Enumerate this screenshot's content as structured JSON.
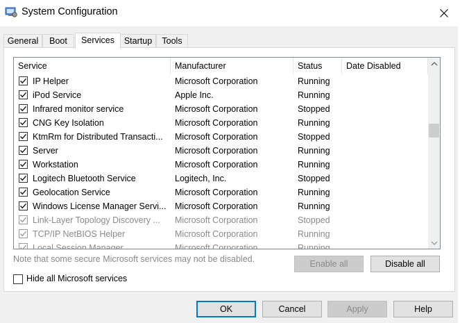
{
  "window": {
    "title": "System Configuration",
    "icon": "system-config-icon"
  },
  "tabs": [
    {
      "label": "General",
      "active": false
    },
    {
      "label": "Boot",
      "active": false
    },
    {
      "label": "Services",
      "active": true
    },
    {
      "label": "Startup",
      "active": false
    },
    {
      "label": "Tools",
      "active": false
    }
  ],
  "services": {
    "columns": [
      "Service",
      "Manufacturer",
      "Status",
      "Date Disabled"
    ],
    "rows": [
      {
        "name": "IP Helper",
        "manufacturer": "Microsoft Corporation",
        "status": "Running",
        "date_disabled": "",
        "checked": true,
        "enabled": true
      },
      {
        "name": "iPod Service",
        "manufacturer": "Apple Inc.",
        "status": "Running",
        "date_disabled": "",
        "checked": true,
        "enabled": true
      },
      {
        "name": "Infrared monitor service",
        "manufacturer": "Microsoft Corporation",
        "status": "Stopped",
        "date_disabled": "",
        "checked": true,
        "enabled": true
      },
      {
        "name": "CNG Key Isolation",
        "manufacturer": "Microsoft Corporation",
        "status": "Running",
        "date_disabled": "",
        "checked": true,
        "enabled": true
      },
      {
        "name": "KtmRm for Distributed Transacti...",
        "manufacturer": "Microsoft Corporation",
        "status": "Stopped",
        "date_disabled": "",
        "checked": true,
        "enabled": true
      },
      {
        "name": "Server",
        "manufacturer": "Microsoft Corporation",
        "status": "Running",
        "date_disabled": "",
        "checked": true,
        "enabled": true
      },
      {
        "name": "Workstation",
        "manufacturer": "Microsoft Corporation",
        "status": "Running",
        "date_disabled": "",
        "checked": true,
        "enabled": true
      },
      {
        "name": "Logitech Bluetooth Service",
        "manufacturer": "Logitech, Inc.",
        "status": "Stopped",
        "date_disabled": "",
        "checked": true,
        "enabled": true
      },
      {
        "name": "Geolocation Service",
        "manufacturer": "Microsoft Corporation",
        "status": "Running",
        "date_disabled": "",
        "checked": true,
        "enabled": true
      },
      {
        "name": "Windows License Manager Servi...",
        "manufacturer": "Microsoft Corporation",
        "status": "Running",
        "date_disabled": "",
        "checked": true,
        "enabled": true
      },
      {
        "name": "Link-Layer Topology Discovery ...",
        "manufacturer": "Microsoft Corporation",
        "status": "Stopped",
        "date_disabled": "",
        "checked": true,
        "enabled": false
      },
      {
        "name": "TCP/IP NetBIOS Helper",
        "manufacturer": "Microsoft Corporation",
        "status": "Running",
        "date_disabled": "",
        "checked": true,
        "enabled": false
      },
      {
        "name": "Local Session Manager",
        "manufacturer": "Microsoft Corporation",
        "status": "Running",
        "date_disabled": "",
        "checked": true,
        "enabled": false
      }
    ]
  },
  "note": "Note that some secure Microsoft services may not be disabled.",
  "buttons": {
    "enable_all": "Enable all",
    "disable_all": "Disable all",
    "ok": "OK",
    "cancel": "Cancel",
    "apply": "Apply",
    "help": "Help"
  },
  "hide_ms": {
    "label": "Hide all Microsoft services",
    "checked": false
  },
  "colors": {
    "focus": "#0078d7",
    "disabled_text": "#8a8a8a"
  }
}
